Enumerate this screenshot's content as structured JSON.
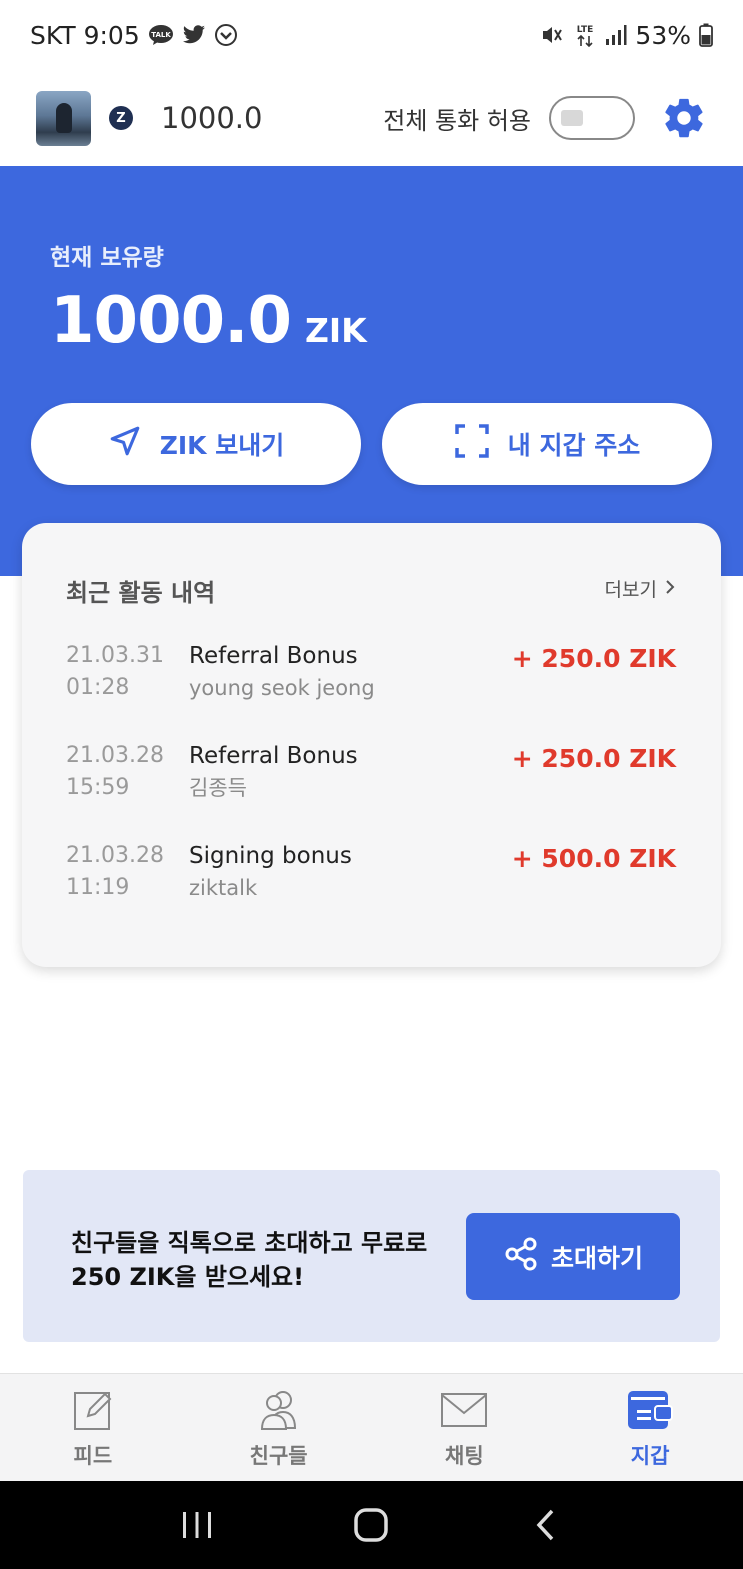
{
  "status_bar": {
    "carrier": "SKT",
    "time": "9:05",
    "network": "LTE",
    "battery": "53%"
  },
  "header": {
    "coin_symbol": "Z",
    "balance": "1000.0",
    "call_label": "전체 통화 허용",
    "call_toggle_on": false
  },
  "summary": {
    "label": "현재 보유량",
    "value": "1000.0",
    "unit": "ZIK",
    "send_button": "ZIK 보내기",
    "wallet_button": "내 지갑 주소"
  },
  "activity": {
    "title": "최근 활동 내역",
    "more_label": "더보기",
    "items": [
      {
        "date": "21.03.31",
        "time": "01:28",
        "title": "Referral Bonus",
        "subtitle": "young seok jeong",
        "amount": "+ 250.0 ZIK"
      },
      {
        "date": "21.03.28",
        "time": "15:59",
        "title": "Referral Bonus",
        "subtitle": "김종득",
        "amount": "+ 250.0 ZIK"
      },
      {
        "date": "21.03.28",
        "time": "11:19",
        "title": "Signing bonus",
        "subtitle": "ziktalk",
        "amount": "+ 500.0 ZIK"
      }
    ]
  },
  "invite": {
    "line1": "친구들을 직톡으로 초대하고 무료로",
    "line2": "250 ZIK을 받으세요!",
    "button": "초대하기"
  },
  "bottom_nav": {
    "items": [
      {
        "label": "피드",
        "icon": "edit-icon",
        "active": false
      },
      {
        "label": "친구들",
        "icon": "friends-icon",
        "active": false
      },
      {
        "label": "채팅",
        "icon": "mail-icon",
        "active": false
      },
      {
        "label": "지갑",
        "icon": "wallet-icon",
        "active": true
      }
    ]
  },
  "colors": {
    "brand_blue": "#3d68de",
    "amount_red": "#e03a2c"
  }
}
